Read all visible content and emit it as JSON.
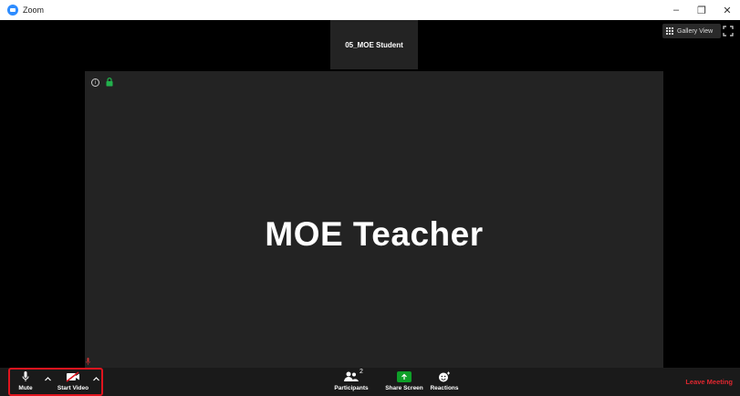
{
  "window": {
    "title": "Zoom",
    "controls": [
      "–",
      "❐",
      "✕"
    ]
  },
  "meeting": {
    "thumbnail_name": "05_MOE Student",
    "gallery_view_label": "Gallery View",
    "active_speaker": "MOE Teacher"
  },
  "toolbar": {
    "mute_label": "Mute",
    "start_video_label": "Start Video",
    "participants_label": "Participants",
    "participants_count": "2",
    "share_screen_label": "Share Screen",
    "reactions_label": "Reactions",
    "leave_label": "Leave Meeting"
  },
  "colors": {
    "accent_blue": "#2D8CFF",
    "share_green": "#0e9f28",
    "leave_red": "#e0272f",
    "highlight_red": "#e0141e"
  },
  "icons": {
    "app": "zoom-icon",
    "info": "info-icon",
    "lock": "lock-icon",
    "mic": "microphone-icon",
    "video": "video-off-icon",
    "participants": "participants-icon",
    "share": "share-screen-icon",
    "reactions": "reactions-icon",
    "gallery": "grid-icon",
    "fullscreen": "fullscreen-icon"
  }
}
